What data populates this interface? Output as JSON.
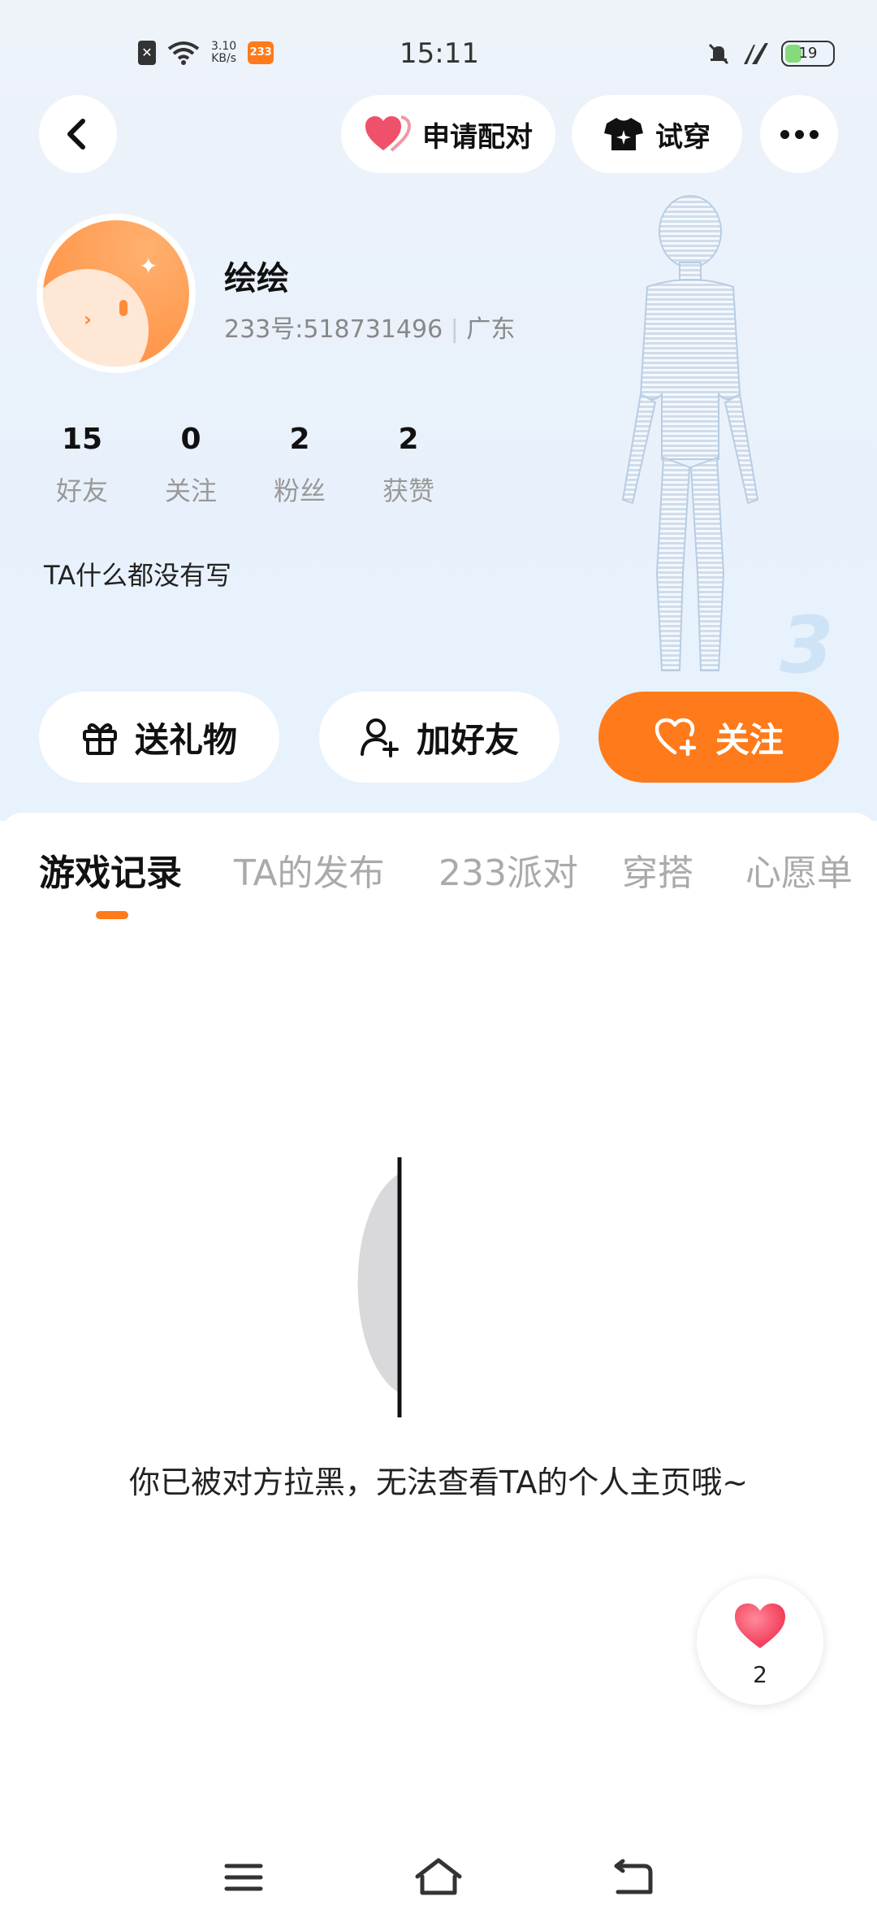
{
  "status_bar": {
    "time": "15:11",
    "net_speed_value": "3.10",
    "net_speed_unit": "KB/s",
    "app_badge": "233",
    "battery": "19"
  },
  "topbar": {
    "pair_label": "申请配对",
    "try_on_label": "试穿"
  },
  "profile": {
    "name": "绘绘",
    "uid": "233号:518731496",
    "region": "广东",
    "bio": "TA什么都没有写"
  },
  "stats": [
    {
      "num": "15",
      "label": "好友"
    },
    {
      "num": "0",
      "label": "关注"
    },
    {
      "num": "2",
      "label": "粉丝"
    },
    {
      "num": "2",
      "label": "获赞"
    }
  ],
  "actions": {
    "gift": "送礼物",
    "add_friend": "加好友",
    "follow": "关注"
  },
  "tabs": [
    {
      "label": "游戏记录"
    },
    {
      "label": "TA的发布"
    },
    {
      "label": "233派对"
    },
    {
      "label": "穿搭"
    },
    {
      "label": "心愿单"
    }
  ],
  "empty_message": "你已被对方拉黑，无法查看TA的个人主页哦~",
  "like_count": "2",
  "colors": {
    "accent": "#ff7a1a",
    "heart": "#f0516a"
  },
  "icons": [
    "back-icon",
    "heart-icon",
    "tshirt-icon",
    "more-icon",
    "gift-icon",
    "add-user-icon",
    "heart-plus-icon",
    "menu-icon",
    "home-icon",
    "return-icon"
  ]
}
